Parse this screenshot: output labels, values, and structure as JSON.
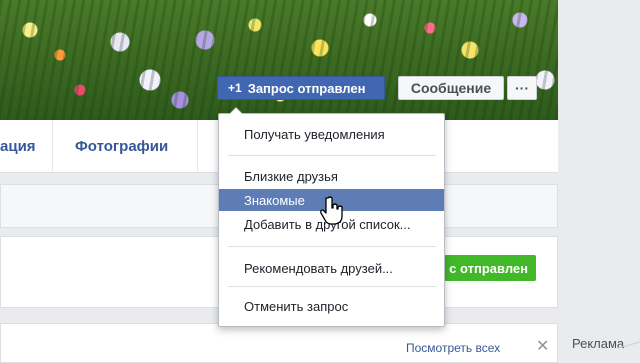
{
  "profile": {
    "friend_request_button": "Запрос отправлен",
    "friend_request_plus": "+1",
    "message_button": "Сообщение",
    "more_button": "···"
  },
  "tabs": [
    "ация",
    "Фотографии"
  ],
  "dropdown": {
    "items": [
      "Получать уведомления",
      "Близкие друзья",
      "Знакомые",
      "Добавить в другой список...",
      "Рекомендовать друзей...",
      "Отменить запрос"
    ],
    "active_index": 2
  },
  "suggestion": {
    "button_label": "с отправлен",
    "see_all": "Посмотреть всех",
    "close": "✕"
  },
  "sidebar": {
    "ads_label": "Реклама"
  },
  "colors": {
    "primary": "#4267b2",
    "highlight": "#5e7db4",
    "green": "#42b72a"
  }
}
